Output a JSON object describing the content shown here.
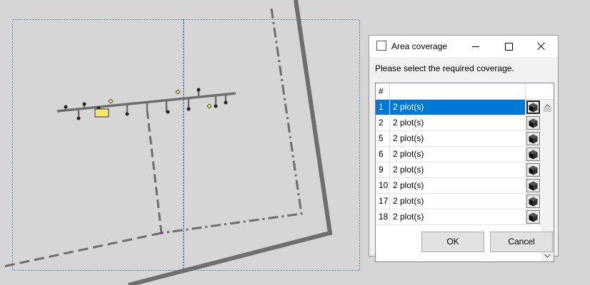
{
  "dialog": {
    "title": "Area coverage",
    "prompt": "Please select the required coverage.",
    "ok_label": "OK",
    "cancel_label": "Cancel",
    "grid": {
      "header_number": "#",
      "rows": [
        {
          "number": "1",
          "label": "2 plot(s)",
          "selected": true
        },
        {
          "number": "2",
          "label": "2 plot(s)",
          "selected": false
        },
        {
          "number": "5",
          "label": "2 plot(s)",
          "selected": false
        },
        {
          "number": "6",
          "label": "2 plot(s)",
          "selected": false
        },
        {
          "number": "9",
          "label": "2 plot(s)",
          "selected": false
        },
        {
          "number": "10",
          "label": "2 plot(s)",
          "selected": false
        },
        {
          "number": "17",
          "label": "2 plot(s)",
          "selected": false
        },
        {
          "number": "18",
          "label": "2 plot(s)",
          "selected": false
        }
      ]
    }
  },
  "colors": {
    "selection": "#0078d7",
    "canvas_background": "#d6d6d6",
    "frame_outline": "#4a78b8",
    "road": "#6e6e6e",
    "marker_yellow": "#f4e76b",
    "marker_magenta": "#d400d4"
  },
  "icons": {
    "title_icon": "checkbox-icon",
    "row_button": "cube-icon",
    "minimize": "minimize-icon",
    "maximize": "maximize-icon",
    "close": "close-icon"
  }
}
